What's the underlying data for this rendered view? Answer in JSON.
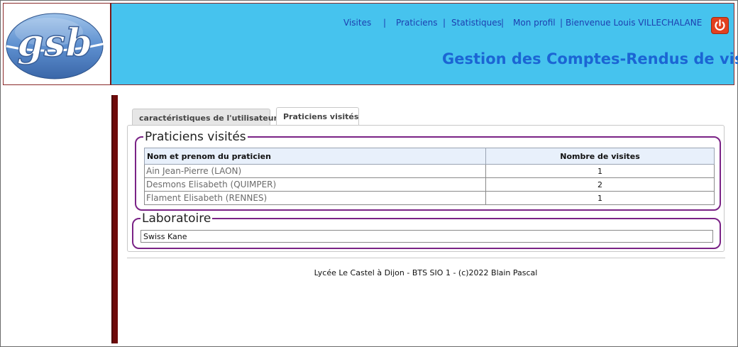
{
  "header": {
    "nav": [
      {
        "label": "Visites"
      },
      {
        "label": "Praticiens"
      },
      {
        "label": "Statistiques"
      },
      {
        "label": "Mon profil"
      }
    ],
    "separator": "|",
    "welcome": "Bienvenue Louis VILLECHALANE",
    "title": "Gestion des Comptes-Rendus de visites",
    "logo_text": "gsb"
  },
  "tabs": [
    {
      "label": "caractéristiques de l'utilisateur",
      "active": false
    },
    {
      "label": "Praticiens visités",
      "active": true
    }
  ],
  "praticiens": {
    "legend": "Praticiens visités",
    "columns": [
      "Nom et prenom du praticien",
      "Nombre de visites"
    ],
    "rows": [
      {
        "name": "Ain Jean-Pierre (LAON)",
        "visits": "1"
      },
      {
        "name": "Desmons Elisabeth (QUIMPER)",
        "visits": "2"
      },
      {
        "name": "Flament Elisabeth (RENNES)",
        "visits": "1"
      }
    ]
  },
  "laboratoire": {
    "legend": "Laboratoire",
    "value": "Swiss Kane"
  },
  "footer": "Lycée Le Castel à Dijon - BTS SIO 1 - (c)2022 Blain Pascal",
  "colors": {
    "header_bg": "#46c3ee",
    "title": "#1b65d4",
    "fieldset_border": "#7a2386",
    "left_bar": "#6e0a0a"
  },
  "icons": {
    "power": "power-icon"
  }
}
